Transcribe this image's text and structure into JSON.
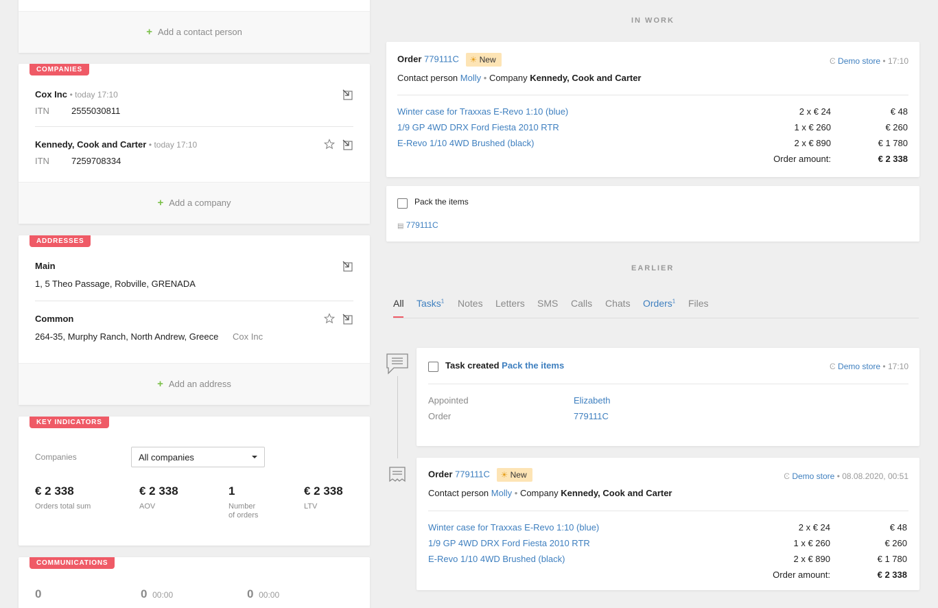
{
  "contacts": {
    "add_label": "Add a contact person"
  },
  "companies": {
    "tag": "COMPANIES",
    "items": [
      {
        "name": "Cox Inc",
        "time": "today 17:10",
        "itn_label": "ITN",
        "itn": "2555030811"
      },
      {
        "name": "Kennedy, Cook and Carter",
        "time": "today 17:10",
        "itn_label": "ITN",
        "itn": "7259708334"
      }
    ],
    "add_label": "Add a company"
  },
  "addresses": {
    "tag": "ADDRESSES",
    "items": [
      {
        "name": "Main",
        "address": "1, 5 Theo Passage, Robville, GRENADA",
        "company": ""
      },
      {
        "name": "Common",
        "address": "264-35, Murphy Ranch, North Andrew, Greece",
        "company": "Cox Inc"
      }
    ],
    "add_label": "Add an address"
  },
  "key_indicators": {
    "tag": "KEY INDICATORS",
    "filter_label": "Companies",
    "filter_value": "All companies",
    "metrics": [
      {
        "value": "€ 2 338",
        "label": "Orders total sum"
      },
      {
        "value": "€ 2 338",
        "label": "AOV"
      },
      {
        "value": "1",
        "label": "Number of orders"
      },
      {
        "value": "€ 2 338",
        "label": "LTV"
      }
    ]
  },
  "communications": {
    "tag": "COMMUNICATIONS",
    "items": [
      {
        "value": "0",
        "time": ""
      },
      {
        "value": "0",
        "time": "00:00"
      },
      {
        "value": "0",
        "time": "00:00"
      }
    ]
  },
  "in_work": {
    "title": "IN WORK",
    "order": {
      "label": "Order",
      "number": "779111C",
      "status": "New",
      "store": "Demo store",
      "time": "17:10",
      "contact_label": "Contact person",
      "contact": "Molly",
      "company_label": "Company",
      "company": "Kennedy, Cook and Carter",
      "items": [
        {
          "name": "Winter case for Traxxas E-Revo 1:10 (blue)",
          "qty": "2 x € 24",
          "sum": "€ 48"
        },
        {
          "name": "1/9 GP 4WD DRX Ford Fiesta 2010 RTR",
          "qty": "1 x € 260",
          "sum": "€ 260"
        },
        {
          "name": "E-Revo 1/10 4WD Brushed (black)",
          "qty": "2 x € 890",
          "sum": "€ 1 780"
        }
      ],
      "total_label": "Order amount:",
      "total": "€ 2 338"
    },
    "task": {
      "title": "Pack the items",
      "order_ref": "779111C"
    }
  },
  "earlier": {
    "title": "EARLIER",
    "tabs": [
      {
        "label": "All",
        "count": ""
      },
      {
        "label": "Tasks",
        "count": "1"
      },
      {
        "label": "Notes",
        "count": ""
      },
      {
        "label": "Letters",
        "count": ""
      },
      {
        "label": "SMS",
        "count": ""
      },
      {
        "label": "Calls",
        "count": ""
      },
      {
        "label": "Chats",
        "count": ""
      },
      {
        "label": "Orders",
        "count": "1"
      },
      {
        "label": "Files",
        "count": ""
      }
    ],
    "task_event": {
      "prefix": "Task created",
      "title": "Pack the items",
      "store": "Demo store",
      "time": "17:10",
      "appointed_label": "Appointed",
      "appointed": "Elizabeth",
      "order_label": "Order",
      "order": "779111C"
    },
    "order_event": {
      "label": "Order",
      "number": "779111C",
      "status": "New",
      "store": "Demo store",
      "time": "08.08.2020, 00:51",
      "contact_label": "Contact person",
      "contact": "Molly",
      "company_label": "Company",
      "company": "Kennedy, Cook and Carter",
      "items": [
        {
          "name": "Winter case for Traxxas E-Revo 1:10 (blue)",
          "qty": "2 x € 24",
          "sum": "€ 48"
        },
        {
          "name": "1/9 GP 4WD DRX Ford Fiesta 2010 RTR",
          "qty": "1 x € 260",
          "sum": "€ 260"
        },
        {
          "name": "E-Revo 1/10 4WD Brushed (black)",
          "qty": "2 x € 890",
          "sum": "€ 1 780"
        }
      ],
      "total_label": "Order amount:",
      "total": "€ 2 338"
    }
  }
}
